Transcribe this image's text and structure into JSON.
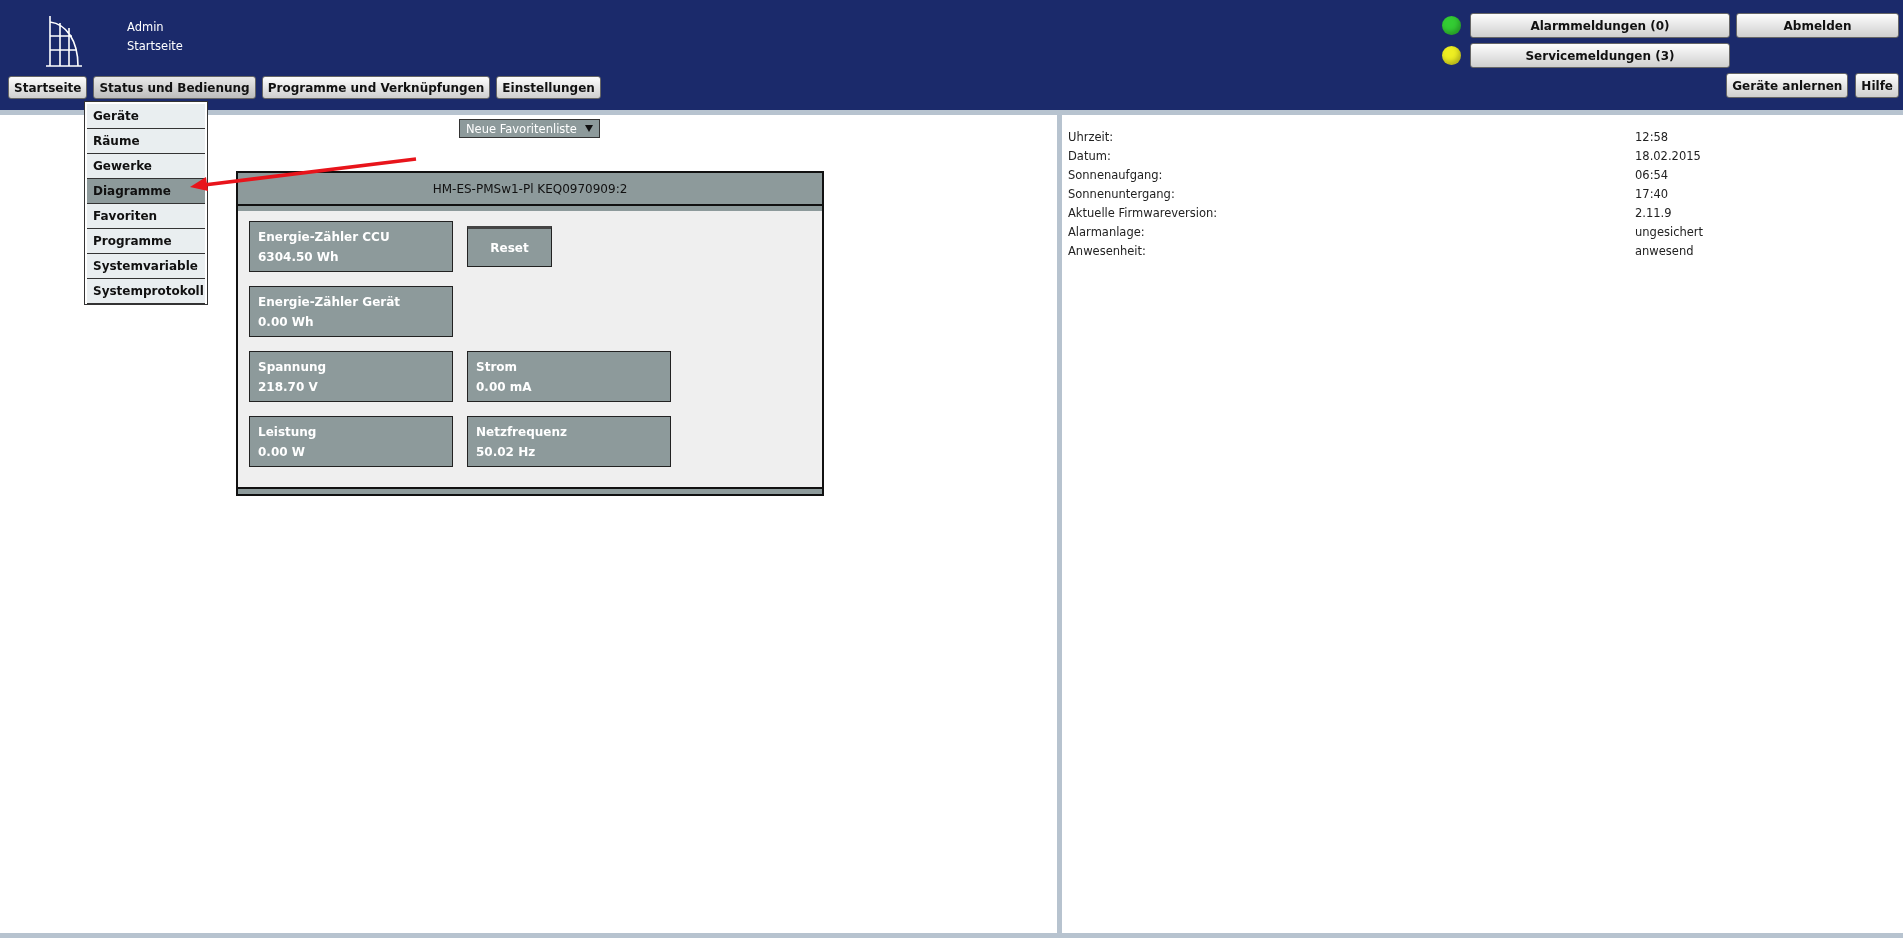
{
  "header": {
    "user": "Admin",
    "page": "Startseite"
  },
  "nav": [
    {
      "label": "Startseite",
      "expanded": false
    },
    {
      "label": "Status und Bedienung",
      "expanded": true
    },
    {
      "label": "Programme und Verknüpfungen",
      "expanded": false
    },
    {
      "label": "Einstellungen",
      "expanded": false
    }
  ],
  "nav_menu": [
    {
      "label": "Geräte",
      "selected": false
    },
    {
      "label": "Räume",
      "selected": false
    },
    {
      "label": "Gewerke",
      "selected": false
    },
    {
      "label": "Diagramme",
      "selected": true
    },
    {
      "label": "Favoriten",
      "selected": false
    },
    {
      "label": "Programme",
      "selected": false
    },
    {
      "label": "Systemvariable",
      "selected": false
    },
    {
      "label": "Systemprotokoll",
      "selected": false
    }
  ],
  "messages": [
    {
      "label": "Alarmmeldungen (0)",
      "color": "#33cc33"
    },
    {
      "label": "Servicemeldungen (3)",
      "color": "#eeee22"
    }
  ],
  "logout": "Abmelden",
  "tools": [
    "Geräte anlernen",
    "Hilfe"
  ],
  "favorites_select": {
    "value": "Neue Favoritenliste"
  },
  "device_card": {
    "title": "HM-ES-PMSw1-Pl KEQ0970909:2",
    "rows": [
      [
        {
          "kind": "reading",
          "label": "Energie-Zähler CCU",
          "value": "6304.50 Wh"
        },
        {
          "kind": "button",
          "label": "Reset"
        }
      ],
      [
        {
          "kind": "reading",
          "label": "Energie-Zähler Gerät",
          "value": "0.00 Wh"
        }
      ],
      [
        {
          "kind": "reading",
          "label": "Spannung",
          "value": "218.70 V"
        },
        {
          "kind": "reading",
          "label": "Strom",
          "value": "0.00 mA"
        }
      ],
      [
        {
          "kind": "reading",
          "label": "Leistung",
          "value": "0.00 W"
        },
        {
          "kind": "reading",
          "label": "Netzfrequenz",
          "value": "50.02 Hz"
        }
      ]
    ]
  },
  "system_info": [
    {
      "label": "Uhrzeit:",
      "value": "12:58"
    },
    {
      "label": "Datum:",
      "value": "18.02.2015"
    },
    {
      "label": "Sonnenaufgang:",
      "value": "06:54"
    },
    {
      "label": "Sonnenuntergang:",
      "value": "17:40"
    },
    {
      "label": "Aktuelle Firmwareversion:",
      "value": "2.11.9"
    },
    {
      "label": "Alarmanlage:",
      "value": "ungesichert"
    },
    {
      "label": "Anwesenheit:",
      "value": "anwesend"
    }
  ]
}
